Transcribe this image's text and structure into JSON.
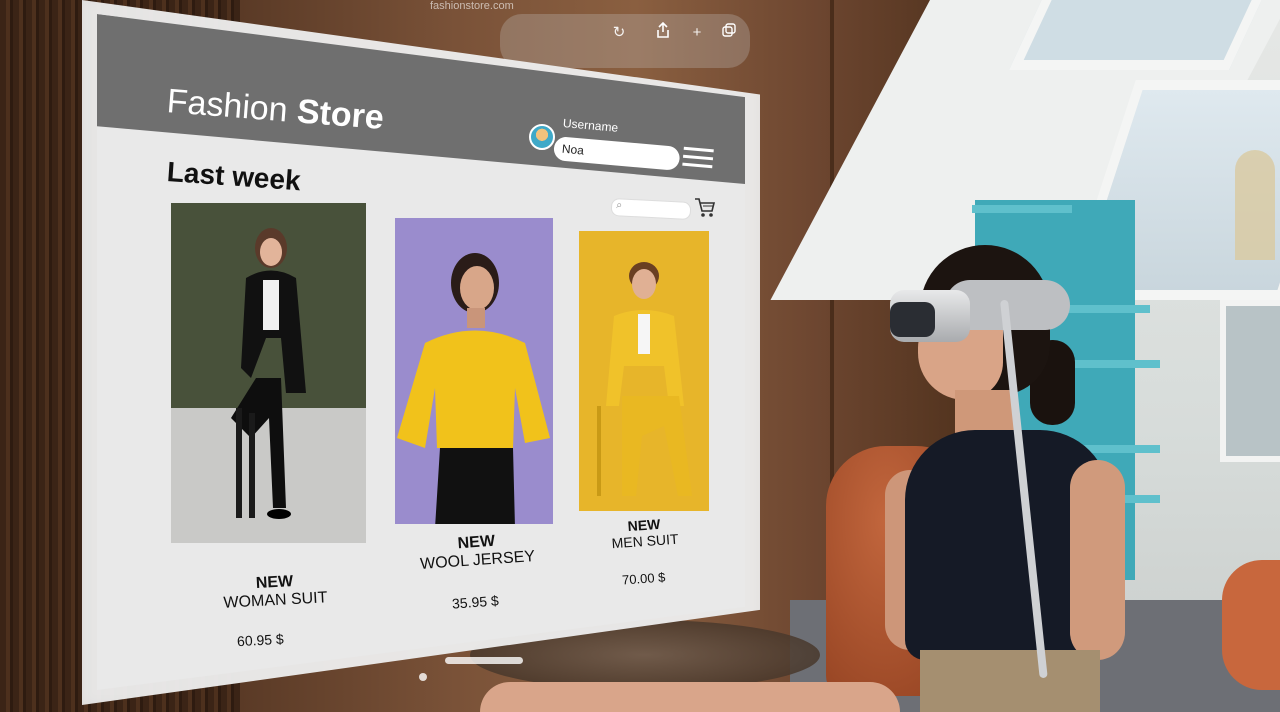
{
  "browser": {
    "url": "fashionstore.com",
    "toolbar": {
      "reload_icon": "reload-icon",
      "share_icon": "share-icon",
      "add_tab_icon": "plus-icon",
      "tabs_icon": "tabs-icon"
    }
  },
  "header": {
    "brand_light": "Fashion",
    "brand_bold": "Store",
    "username_label": "Username",
    "username_value": "Noa"
  },
  "main": {
    "section_title": "Last week",
    "products": [
      {
        "badge": "NEW",
        "name": "WOMAN SUIT",
        "price": "60.95 $"
      },
      {
        "badge": "NEW",
        "name": "WOOL JERSEY",
        "price": "35.95 $"
      },
      {
        "badge": "NEW",
        "name": "MEN SUIT",
        "price": "70.00 $"
      }
    ]
  },
  "colors": {
    "header_band": "#6f6f6f",
    "screen_bg": "#e9e9e9",
    "card1_bg": "#48513a",
    "card2_bg": "#9a8ccd",
    "card3_bg": "#e7b52a"
  }
}
